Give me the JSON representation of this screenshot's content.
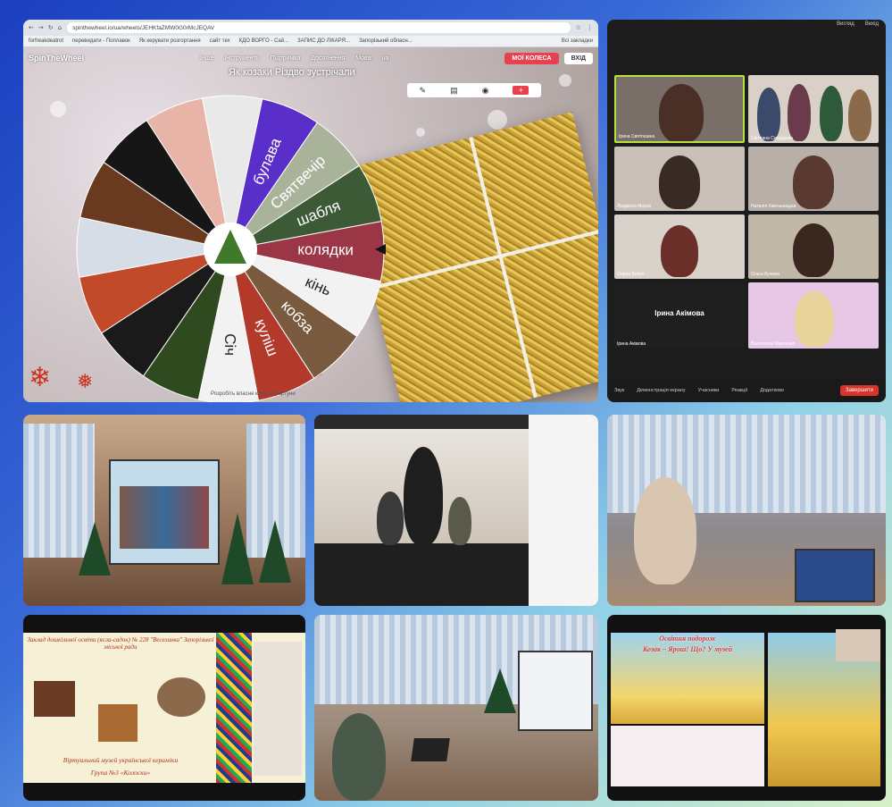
{
  "browser": {
    "address": "spinthewheel.io/ua/wheels/JEHKfaZMW0G0rMcJEQAV",
    "bookmarks": [
      "forfreakdeatrot",
      "перевидати - Поплавок",
      "Як керувати розгортання",
      "сайт тех",
      "КДО ВОРГО - Сай...",
      "ЗАПИС ДО ЛІКАРЯ...",
      "Запорізький обласн...",
      "Всі закладки"
    ]
  },
  "spinwheel": {
    "logo": "SpinTheWheel",
    "menu": [
      "Інше",
      "Інструменти",
      "Підтримка",
      "Досягнення",
      "Мова",
      "ua"
    ],
    "my_wheels_label": "МОЇ КОЛЕСА",
    "login_label": "ВХІД",
    "title": "Як козаки Різдво зустрічали",
    "segments": [
      {
        "label": "булава",
        "color": "#5a2ec8",
        "kind": "text"
      },
      {
        "label": "Святвечір",
        "color": "#a9b39a",
        "kind": "text"
      },
      {
        "label": "шабля",
        "color": "#3d5a36",
        "kind": "text"
      },
      {
        "label": "колядки",
        "color": "#9a3646",
        "kind": "text"
      },
      {
        "label": "кінь",
        "color": "#f2f2f2",
        "kind": "text"
      },
      {
        "label": "кобза",
        "color": "#7a5a3e",
        "kind": "text"
      },
      {
        "label": "куліш",
        "color": "#b33a2a",
        "kind": "text"
      },
      {
        "label": "Січ",
        "color": "#f2f2f2",
        "kind": "text"
      },
      {
        "label": "",
        "color": "#2f4a1e",
        "kind": "image"
      },
      {
        "label": "",
        "color": "#1a1a1a",
        "kind": "image"
      },
      {
        "label": "",
        "color": "#c04a2a",
        "kind": "image"
      },
      {
        "label": "",
        "color": "#d7dde6",
        "kind": "image"
      },
      {
        "label": "",
        "color": "#6a3a20",
        "kind": "image"
      },
      {
        "label": "",
        "color": "#161616",
        "kind": "image"
      },
      {
        "label": "",
        "color": "#e8b4a8",
        "kind": "image"
      },
      {
        "label": "",
        "color": "#e9e9e9",
        "kind": "image"
      }
    ],
    "bottom_caption": "Розробіть власне колесо фортуни"
  },
  "zoom": {
    "top_right": [
      "Вигляд",
      "Вихід"
    ],
    "participants": [
      {
        "name": "Ірина Святошина"
      },
      {
        "name": "Світлана Скворцова"
      },
      {
        "name": "Людмила Мороз"
      },
      {
        "name": "Наталія Хмельницька"
      },
      {
        "name": "Олена Бобко"
      },
      {
        "name": "Ольга Кучман"
      },
      {
        "name": "Ірина Акімова"
      },
      {
        "name": "Валентина Марченко"
      }
    ],
    "center_name": "Ірина Акімова",
    "controls": [
      "Звук",
      "Демонстрація екрану",
      "Учасники",
      "Реакції",
      "Додатково"
    ],
    "end_label": "Завершити"
  },
  "slide": {
    "header": "Заклад дошкільної освіти (ясла-садок) № 228 \"Веселинка\" Запорізької міської ради",
    "footer1": "Віртуальний музей української кераміки",
    "footer2": "Група №3 «Колоски»"
  },
  "cossack": {
    "header": "Освітня подорож",
    "title": "Козак – Ярош! Що? У музей"
  },
  "colors": {
    "accent": "#e8404f",
    "zoom_bg": "#1c1c1c",
    "frame_gradient_start": "#1b3fbf"
  }
}
